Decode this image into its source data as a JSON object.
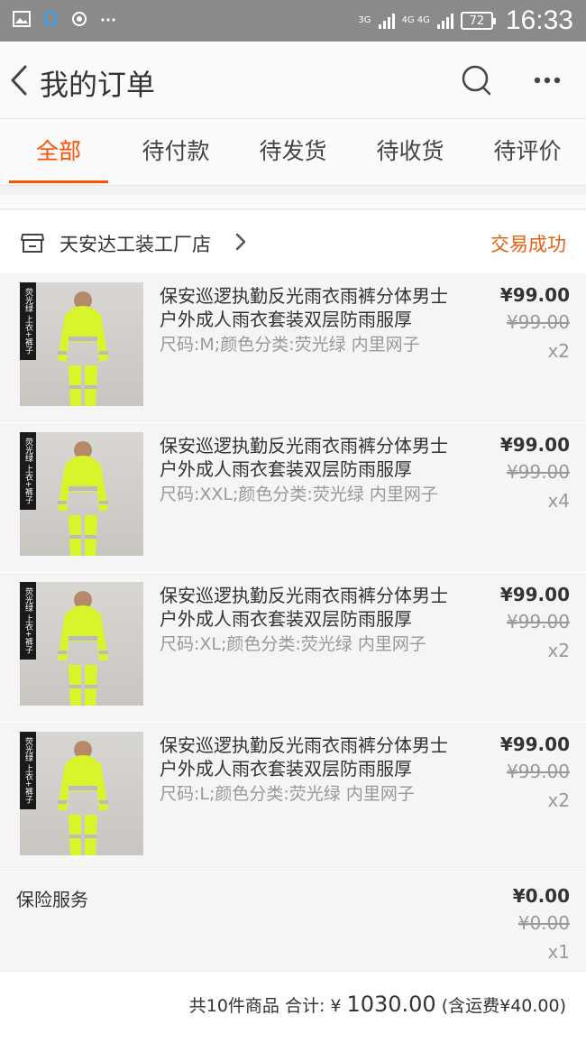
{
  "status_bar": {
    "net1": "3G",
    "net2": "4G 4G",
    "battery": "72",
    "time": "16:33"
  },
  "header": {
    "title": "我的订单"
  },
  "tabs": [
    {
      "label": "全部",
      "active": true
    },
    {
      "label": "待付款"
    },
    {
      "label": "待发货"
    },
    {
      "label": "待收货"
    },
    {
      "label": "待评价"
    }
  ],
  "order": {
    "shop_name": "天安达工装工厂店",
    "status": "交易成功",
    "items": [
      {
        "title": "保安巡逻执勤反光雨衣雨裤分体男士户外成人雨衣套装双层防雨服厚",
        "sku": "尺码:M;颜色分类:荧光绿 内里网子",
        "price": "¥99.00",
        "orig_price": "¥99.00",
        "qty": "x2",
        "thumb_tag": "荧光绿 上衣+裤子"
      },
      {
        "title": "保安巡逻执勤反光雨衣雨裤分体男士户外成人雨衣套装双层防雨服厚",
        "sku": "尺码:XXL;颜色分类:荧光绿 内里网子",
        "price": "¥99.00",
        "orig_price": "¥99.00",
        "qty": "x4",
        "thumb_tag": "荧光绿 上衣+裤子"
      },
      {
        "title": "保安巡逻执勤反光雨衣雨裤分体男士户外成人雨衣套装双层防雨服厚",
        "sku": "尺码:XL;颜色分类:荧光绿 内里网子",
        "price": "¥99.00",
        "orig_price": "¥99.00",
        "qty": "x2",
        "thumb_tag": "荧光绿 上衣+裤子"
      },
      {
        "title": "保安巡逻执勤反光雨衣雨裤分体男士户外成人雨衣套装双层防雨服厚",
        "sku": "尺码:L;颜色分类:荧光绿 内里网子",
        "price": "¥99.00",
        "orig_price": "¥99.00",
        "qty": "x2",
        "thumb_tag": "荧光绿 上衣+裤子"
      }
    ],
    "insurance": {
      "label": "保险服务",
      "price": "¥0.00",
      "orig_price": "¥0.00",
      "qty": "x1"
    },
    "summary": {
      "count_text": "共10件商品",
      "total_label": "合计:",
      "currency": "¥",
      "total_value": "1030.00",
      "shipping_text": "(含运费¥40.00)"
    }
  },
  "colors": {
    "accent": "#ff5000",
    "status": "#e95f10"
  }
}
